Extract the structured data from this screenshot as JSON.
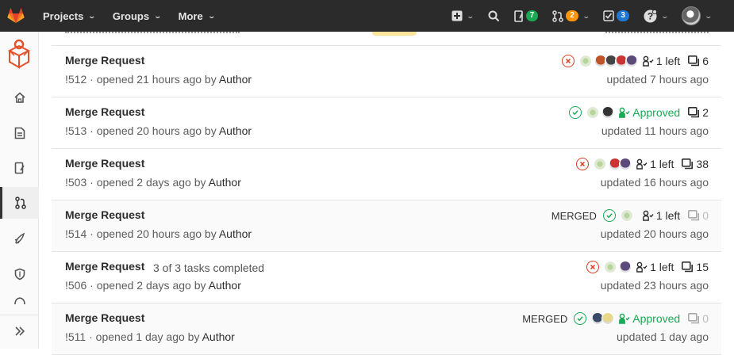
{
  "nav": {
    "projects": "Projects",
    "groups": "Groups",
    "more": "More",
    "issues_count": "7",
    "mr_count": "2",
    "todos_count": "3"
  },
  "colors": {
    "navbar": "#2b2b2b",
    "success": "#1aaa55",
    "failed": "#db3b21",
    "badge_green": "#1aaa55",
    "badge_orange": "#fc9403",
    "badge_blue": "#1f78d1"
  },
  "sidebar": {
    "items": [
      "project-avatar",
      "home-icon",
      "document-icon",
      "issues-icon",
      "merge-request-icon",
      "rocket-icon",
      "shield-icon",
      "package-icon",
      "collapse-icon"
    ]
  },
  "merge_requests": [
    {
      "title": "Merge Request",
      "ref": "!512",
      "opened": "opened 21 hours ago by",
      "author": "Author",
      "tasks": "",
      "state": "",
      "pipeline": "failed",
      "approval": "1 left",
      "approved": false,
      "comments": "6",
      "updated": "updated 7 hours ago",
      "avatars": [
        "#8aaf6a",
        "#c0522c",
        "#444",
        "#c33",
        "#5b4a7a"
      ]
    },
    {
      "title": "Merge Request",
      "ref": "!513",
      "opened": "opened 20 hours ago by",
      "author": "Author",
      "tasks": "",
      "state": "",
      "pipeline": "success",
      "approval": "Approved",
      "approved": true,
      "comments": "2",
      "updated": "updated 11 hours ago",
      "avatars": [
        "#8aaf6a",
        "#333"
      ]
    },
    {
      "title": "Merge Request",
      "ref": "!503",
      "opened": "opened 2 days ago by",
      "author": "Author",
      "tasks": "",
      "state": "",
      "pipeline": "failed",
      "approval": "1 left",
      "approved": false,
      "comments": "38",
      "updated": "updated 16 hours ago",
      "avatars": [
        "#8aaf6a",
        "#c33",
        "#5b4a7a"
      ]
    },
    {
      "title": "Merge Request",
      "ref": "!514",
      "opened": "opened 20 hours ago by",
      "author": "Author",
      "tasks": "",
      "state": "MERGED",
      "pipeline": "success",
      "approval": "1 left",
      "approved": false,
      "comments": "0",
      "updated": "updated 20 hours ago",
      "avatars": [
        "#8aaf6a"
      ]
    },
    {
      "title": "Merge Request",
      "ref": "!506",
      "opened": "opened 2 days ago by",
      "author": "Author",
      "tasks": "3 of 3 tasks completed",
      "state": "",
      "pipeline": "failed",
      "approval": "1 left",
      "approved": false,
      "comments": "15",
      "updated": "updated 23 hours ago",
      "avatars": [
        "#8aaf6a",
        "#5b4a7a"
      ]
    },
    {
      "title": "Merge Request",
      "ref": "!511",
      "opened": "opened 1 day ago by",
      "author": "Author",
      "tasks": "",
      "state": "MERGED",
      "pipeline": "success",
      "approval": "Approved",
      "approved": true,
      "comments": "0",
      "updated": "updated 1 day ago",
      "avatars": [
        "#3a4a6a",
        "#e8d88a"
      ]
    }
  ]
}
